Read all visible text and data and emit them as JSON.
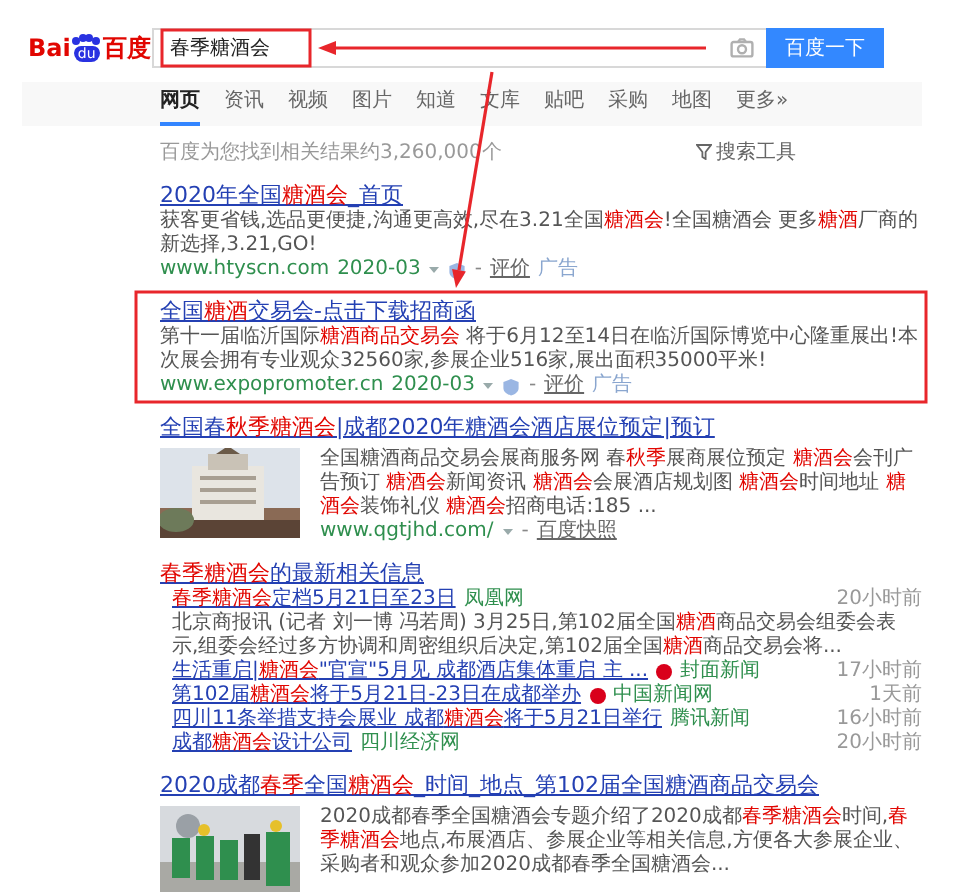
{
  "logo": {
    "left": "Bai",
    "paw": "du",
    "right": "百度"
  },
  "search": {
    "query": "春季糖酒会",
    "boxed": true,
    "button": "百度一下"
  },
  "tabs": [
    {
      "label": "网页",
      "selected": true
    },
    {
      "label": "资讯",
      "selected": false
    },
    {
      "label": "视频",
      "selected": false
    },
    {
      "label": "图片",
      "selected": false
    },
    {
      "label": "知道",
      "selected": false
    },
    {
      "label": "文库",
      "selected": false
    },
    {
      "label": "贴吧",
      "selected": false
    },
    {
      "label": "采购",
      "selected": false
    },
    {
      "label": "地图",
      "selected": false
    },
    {
      "label": "更多»",
      "selected": false
    }
  ],
  "result_count": "百度为您找到相关结果约3,260,000个",
  "search_tools": "搜索工具",
  "results": [
    {
      "kind": "ad",
      "boxed": false,
      "title": "2020年全国**糖酒会**_首页",
      "description": "获客更省钱,选品更便捷,沟通更高效,尽在3.21全国**糖酒会**!全国糖酒会 更多**糖酒**厂商的新选择,3.21,GO!",
      "url": "www.htyscn.com",
      "date": "2020-03",
      "dash": "-",
      "rate": "评价",
      "ad_label": "广告"
    },
    {
      "kind": "ad",
      "boxed": true,
      "title": "全国**糖酒**交易会-点击下载招商函",
      "description": "第十一届临沂国际**糖酒商品交易会** 将于6月12至14日在临沂国际博览中心隆重展出!本次展会拥有专业观众32560家,参展企业516家,展出面积35000平米!",
      "url": "www.expopromoter.cn",
      "date": "2020-03",
      "dash": "-",
      "rate": "评价",
      "ad_label": "广告"
    },
    {
      "title": "全国春**秋季糖酒会**|成都2020年糖酒会酒店展位预定|预订",
      "description": "全国糖酒商品交易会展商服务网 春**秋季**展商展位预定 **糖酒会**会刊广告预订 **糖酒会**新闻资讯 **糖酒会**会展酒店规划图 **糖酒会**时间地址 **糖酒会**装饰礼仪 **糖酒会**招商电话:185 ...",
      "url": "www.qgtjhd.com/",
      "dash": "-",
      "snapshot": "百度快照"
    },
    {
      "kind": "news",
      "title": "**春季糖酒会**的最新相关信息",
      "items": [
        {
          "title": "**春季糖酒会**定档5月21日至23日",
          "source": "凤凰网",
          "time": "20小时前",
          "badge": false,
          "summary": "北京商报讯 (记者 刘一博 冯若周) 3月25日,第102届全国**糖酒**商品交易会组委会表示,组委会经过多方协调和周密组织后决定,第102届全国**糖酒**商品交易会将..."
        },
        {
          "title": "生活重启|**糖酒会**\"官宣\"5月见 成都酒店集体重启 主 ...",
          "source": "封面新闻",
          "time": "17小时前",
          "badge": true
        },
        {
          "title": "第102届**糖酒会**将于5月21日-23日在成都举办",
          "source": "中国新闻网",
          "time": "1天前",
          "badge": true
        },
        {
          "title": "四川11条举措支持会展业 成都**糖酒会**将于5月21日举行",
          "source": "腾讯新闻",
          "time": "16小时前",
          "badge": false
        },
        {
          "title": "成都**糖酒会**设计公司",
          "source": "四川经济网",
          "time": "20小时前",
          "badge": false
        }
      ]
    },
    {
      "title": "2020成都**春季**全国**糖酒会**_时间_地点_第102届全国糖酒商品交易会",
      "description": "2020成都春季全国糖酒会专题介绍了2020成都**春季糖酒会**时间,**春季糖酒会**地点,布展酒店、参展企业等相关信息,方便各大参展企业、采购者和观众参加2020成都春季全国糖酒会..."
    }
  ]
}
